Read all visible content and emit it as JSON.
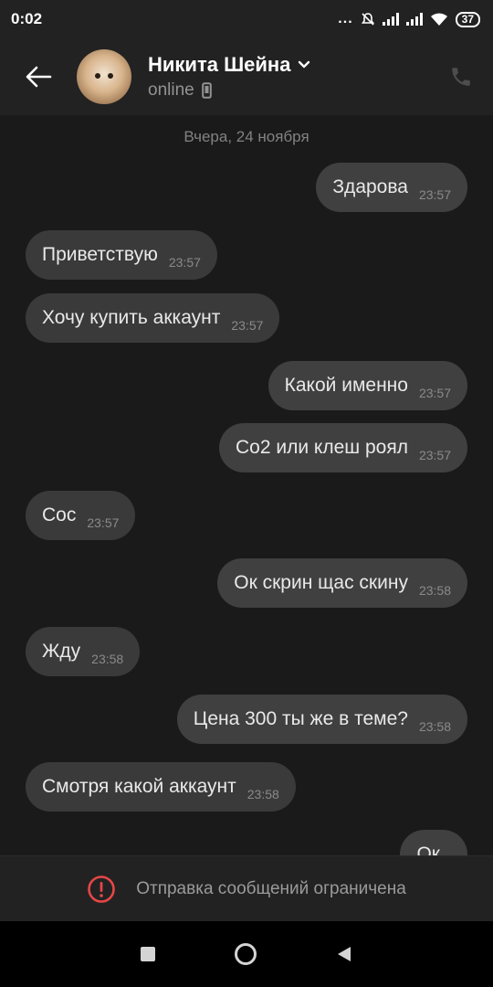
{
  "status_bar": {
    "time": "0:02",
    "dots": "...",
    "battery": "37"
  },
  "header": {
    "name": "Никита Шейна",
    "status": "online"
  },
  "chat": {
    "date_separator": "Вчера, 24 ноября",
    "messages": [
      {
        "text": "Здарова",
        "time": "23:57",
        "direction": "out"
      },
      {
        "text": "Приветствую",
        "time": "23:57",
        "direction": "in"
      },
      {
        "text": "Хочу купить аккаунт",
        "time": "23:57",
        "direction": "in"
      },
      {
        "text": "Какой именно",
        "time": "23:57",
        "direction": "out"
      },
      {
        "text": "Со2 или клеш роял",
        "time": "23:57",
        "direction": "out"
      },
      {
        "text": "Сос",
        "time": "23:57",
        "direction": "in"
      },
      {
        "text": "Ок скрин щас скину",
        "time": "23:58",
        "direction": "out"
      },
      {
        "text": "Жду",
        "time": "23:58",
        "direction": "in"
      },
      {
        "text": "Цена 300 ты же в теме?",
        "time": "23:58",
        "direction": "out"
      },
      {
        "text": "Смотря какой аккаунт",
        "time": "23:58",
        "direction": "in"
      },
      {
        "text": "Ок",
        "time": "",
        "direction": "out"
      }
    ]
  },
  "restriction": {
    "text": "Отправка сообщений ограничена"
  },
  "colors": {
    "background": "#1a1a1a",
    "header": "#222222",
    "bubble": "#3a3a3a",
    "warning": "#e64646"
  }
}
